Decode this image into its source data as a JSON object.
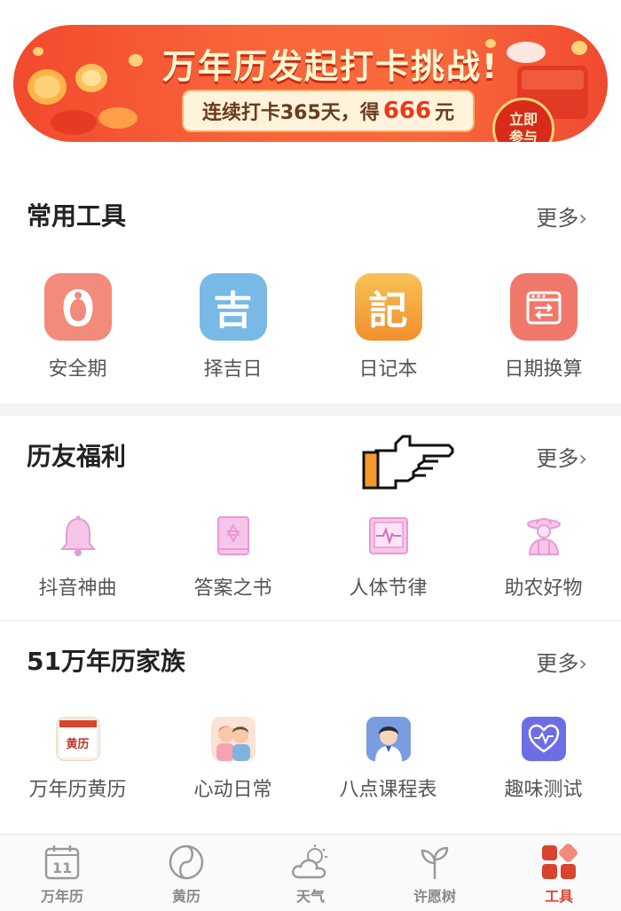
{
  "banner": {
    "title": "万年历发起打卡挑战!",
    "subtitle_prefix": "连续打卡365天，得",
    "amount": "666",
    "subtitle_suffix": "元",
    "join_label_1": "立即",
    "join_label_2": "参与",
    "colors": {
      "bg": "#f24a2e",
      "accent": "#ffd27a"
    }
  },
  "common_tools": {
    "title": "常用工具",
    "more": "更多",
    "items": [
      {
        "label": "安全期",
        "icon": "woman-flower-icon",
        "color": "#f28b7c"
      },
      {
        "label": "择吉日",
        "icon": "ji-character-icon",
        "glyph": "吉",
        "color": "#78b9e6"
      },
      {
        "label": "日记本",
        "icon": "diary-character-icon",
        "glyph": "記",
        "color": "#f4a23c"
      },
      {
        "label": "日期换算",
        "icon": "calendar-convert-icon",
        "color": "#f0786a"
      }
    ]
  },
  "welfare": {
    "title": "历友福利",
    "more": "更多",
    "items": [
      {
        "label": "抖音神曲",
        "icon": "bell-icon"
      },
      {
        "label": "答案之书",
        "icon": "star-book-icon"
      },
      {
        "label": "人体节律",
        "icon": "heartbeat-monitor-icon"
      },
      {
        "label": "助农好物",
        "icon": "farmer-icon"
      }
    ],
    "color": "#e99ad4"
  },
  "family": {
    "title": "51万年历家族",
    "more": "更多",
    "items": [
      {
        "label": "万年历黄历",
        "icon": "huangli-app-icon",
        "badge": "黄历"
      },
      {
        "label": "心动日常",
        "icon": "couple-app-icon"
      },
      {
        "label": "八点课程表",
        "icon": "student-app-icon"
      },
      {
        "label": "趣味测试",
        "icon": "heart-test-app-icon"
      }
    ]
  },
  "tabbar": {
    "calendar_day": "11",
    "items": [
      {
        "label": "万年历",
        "icon": "calendar-icon",
        "active": false
      },
      {
        "label": "黄历",
        "icon": "yin-yang-icon",
        "active": false
      },
      {
        "label": "天气",
        "icon": "weather-icon",
        "active": false
      },
      {
        "label": "许愿树",
        "icon": "sprout-icon",
        "active": false
      },
      {
        "label": "工具",
        "icon": "tools-grid-icon",
        "active": true
      }
    ],
    "active_color": "#d9442e"
  }
}
